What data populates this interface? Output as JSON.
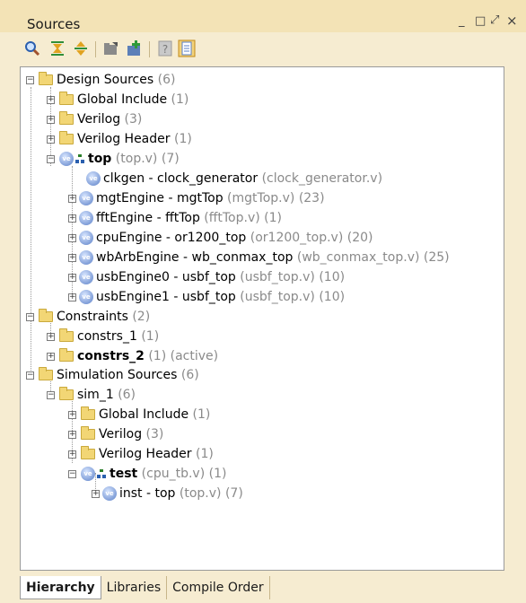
{
  "window": {
    "title": "Sources",
    "controls": {
      "minimize": "_",
      "maximize": "□",
      "float": "⤢",
      "close": "×"
    }
  },
  "toolbar": {
    "icons": [
      "search-icon",
      "collapse-all-icon",
      "expand-all-icon",
      "open-folder-icon",
      "add-sources-icon",
      "help-icon",
      "properties-icon"
    ]
  },
  "tree": {
    "design_sources": {
      "label": "Design Sources",
      "count": "(6)"
    },
    "global_include": {
      "label": "Global Include",
      "count": "(1)"
    },
    "verilog": {
      "label": "Verilog",
      "count": "(3)"
    },
    "verilog_header": {
      "label": "Verilog Header",
      "count": "(1)"
    },
    "top": {
      "label": "top",
      "file": "(top.v)",
      "count": "(7)"
    },
    "clkgen": {
      "label": "clkgen - clock_generator",
      "file": "(clock_generator.v)"
    },
    "mgt": {
      "label": "mgtEngine - mgtTop",
      "file": "(mgtTop.v)",
      "count": "(23)"
    },
    "fft": {
      "label": "fftEngine - fftTop",
      "file": "(fftTop.v)",
      "count": "(1)"
    },
    "cpu": {
      "label": "cpuEngine - or1200_top",
      "file": "(or1200_top.v)",
      "count": "(20)"
    },
    "wbarb": {
      "label": "wbArbEngine - wb_conmax_top",
      "file": "(wb_conmax_top.v)",
      "count": "(25)"
    },
    "usb0": {
      "label": "usbEngine0 - usbf_top",
      "file": "(usbf_top.v)",
      "count": "(10)"
    },
    "usb1": {
      "label": "usbEngine1 - usbf_top",
      "file": "(usbf_top.v)",
      "count": "(10)"
    },
    "constraints": {
      "label": "Constraints",
      "count": "(2)"
    },
    "constrs1": {
      "label": "constrs_1",
      "count": "(1)"
    },
    "constrs2": {
      "label": "constrs_2",
      "count": "(1)",
      "status": "(active)"
    },
    "sim_sources": {
      "label": "Simulation Sources",
      "count": "(6)"
    },
    "sim1": {
      "label": "sim_1",
      "count": "(6)"
    },
    "sim_global_include": {
      "label": "Global Include",
      "count": "(1)"
    },
    "sim_verilog": {
      "label": "Verilog",
      "count": "(3)"
    },
    "sim_verilog_header": {
      "label": "Verilog Header",
      "count": "(1)"
    },
    "test": {
      "label": "test",
      "file": "(cpu_tb.v)",
      "count": "(1)"
    },
    "inst": {
      "label": "inst - top",
      "file": "(top.v)",
      "count": "(7)"
    }
  },
  "tabs": [
    "Hierarchy",
    "Libraries",
    "Compile Order"
  ]
}
